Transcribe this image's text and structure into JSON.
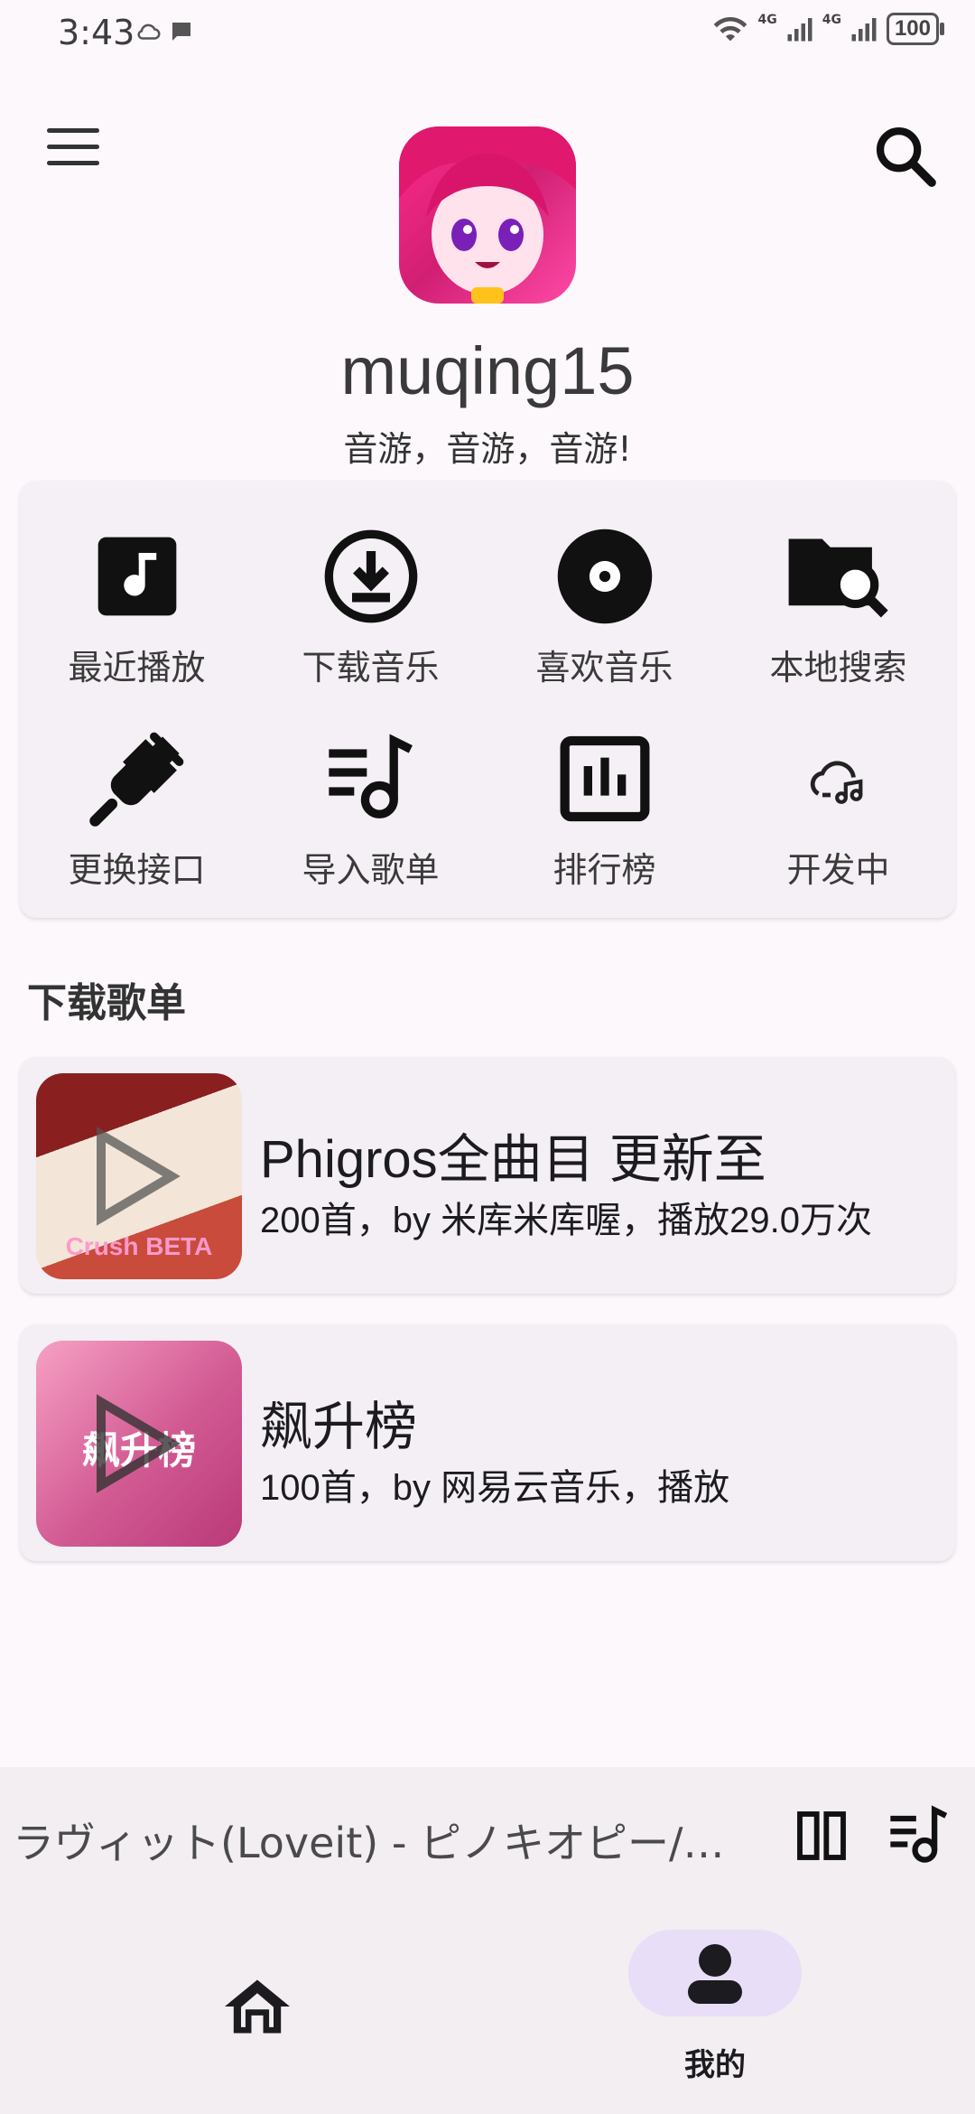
{
  "status_bar": {
    "time": "3:43",
    "battery": "100",
    "network_1": "4G",
    "network_2": "4G"
  },
  "profile": {
    "username": "muqing15",
    "tagline": "音游，音游，音游!"
  },
  "grid": {
    "items": [
      {
        "label": "最近播放",
        "icon": "music-note-square-icon"
      },
      {
        "label": "下载音乐",
        "icon": "download-circle-icon"
      },
      {
        "label": "喜欢音乐",
        "icon": "disc-icon"
      },
      {
        "label": "本地搜索",
        "icon": "folder-search-icon"
      },
      {
        "label": "更换接口",
        "icon": "plug-icon"
      },
      {
        "label": "导入歌单",
        "icon": "playlist-music-icon"
      },
      {
        "label": "排行榜",
        "icon": "chart-bars-icon"
      },
      {
        "label": "开发中",
        "icon": "cloud-music-icon"
      }
    ]
  },
  "section": {
    "title": "下载歌单"
  },
  "playlists": [
    {
      "title": "Phigros全曲目 更新至",
      "subtitle": "200首，by 米库米库喔，播放29.0万次",
      "thumb_text": "Crush BETA"
    },
    {
      "title": "飙升榜",
      "subtitle": "100首，by 网易云音乐，播放",
      "thumb_text": "飙升榜"
    }
  ],
  "player": {
    "track": "ラヴィット(Loveit) - ピノキオピー/初音ミク"
  },
  "nav": {
    "profile_label": "我的"
  },
  "colors": {
    "background": "#fdf8fc",
    "card": "#f5f0f5",
    "nav_pill": "#e8def8"
  }
}
